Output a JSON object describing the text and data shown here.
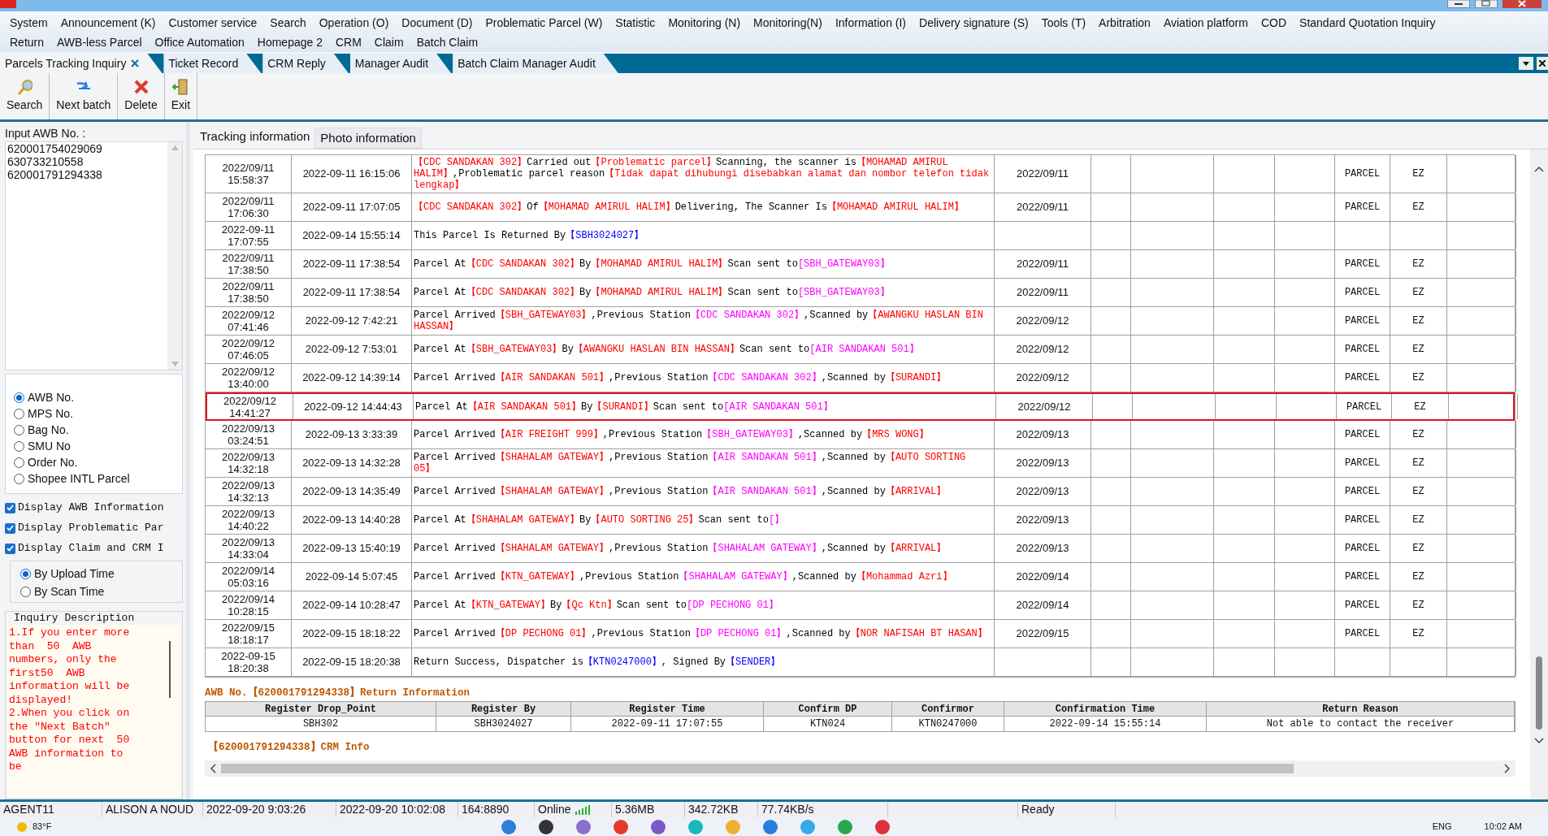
{
  "menu_rows": [
    [
      "System",
      "Announcement (K)",
      "Customer service",
      "Search",
      "Operation (O)",
      "Document (D)",
      "Problematic Parcel (W)",
      "Statistic",
      "Monitoring (N)",
      "Monitoring(N)",
      "Information (I)",
      "Delivery signature (S)",
      "Tools (T)",
      "Arbitration",
      "Aviation platform",
      "COD",
      "Standard Quotation Inquiry"
    ],
    [
      "Return",
      "AWB-less Parcel",
      "Office Automation",
      "Homepage 2",
      "CRM",
      "Claim",
      "Batch Claim"
    ]
  ],
  "doc_tabs": [
    {
      "label": "Parcels Tracking Inquiry",
      "selected": true
    },
    {
      "label": "Ticket Record",
      "selected": false
    },
    {
      "label": "CRM Reply",
      "selected": false
    },
    {
      "label": "Manager Audit",
      "selected": false
    },
    {
      "label": "Batch Claim Manager Audit",
      "selected": false
    }
  ],
  "toolbar": [
    {
      "label": "Search",
      "kind": "search"
    },
    {
      "label": "Next batch",
      "kind": "next"
    },
    {
      "label": "Delete",
      "kind": "delete"
    },
    {
      "label": "Exit",
      "kind": "exit"
    }
  ],
  "awb_input": {
    "label": "Input AWB No. :",
    "lines": [
      "620001754029069",
      "630733210558",
      "620001791294338"
    ]
  },
  "search_type": [
    {
      "label": "AWB No.",
      "selected": true
    },
    {
      "label": "MPS No.",
      "selected": false
    },
    {
      "label": "Bag No.",
      "selected": false
    },
    {
      "label": "SMU No",
      "selected": false
    },
    {
      "label": "Order No.",
      "selected": false
    },
    {
      "label": "Shopee INTL Parcel",
      "selected": false
    }
  ],
  "display_options": [
    {
      "label": "Display AWB Information",
      "checked": true
    },
    {
      "label": "Display Problematic Par",
      "checked": true
    },
    {
      "label": "Display Claim and CRM I",
      "checked": true
    }
  ],
  "time_order": [
    {
      "label": "By Upload Time",
      "selected": true
    },
    {
      "label": "By Scan Time",
      "selected": false
    }
  ],
  "inquiry_description": {
    "title": "Inquiry Description",
    "text": "1.If you enter more than  50  AWB numbers, only the first50  AWB information will be displayed!\n2.When you click on the ″Next Batch″ button for next  50 AWB information to be"
  },
  "info_tabs": [
    {
      "label": "Tracking information",
      "selected": true
    },
    {
      "label": "Photo information",
      "selected": false
    }
  ],
  "tracking_rows": [
    {
      "scan_time": "2022/09/11 15:58:37",
      "upload_time": "2022-09-11 16:15:06",
      "description": [
        {
          "text": "【CDC SANDAKAN 302】",
          "color": "#ff0000"
        },
        {
          "text": "Carried out",
          "color": "#000000"
        },
        {
          "text": "【Problematic parcel】",
          "color": "#ff0000"
        },
        {
          "text": "Scanning, the scanner is",
          "color": "#000000"
        },
        {
          "text": "【MOHAMAD AMIRUL HALIM】",
          "color": "#ff0000"
        },
        {
          "text": ",Problematic parcel reason",
          "color": "#000000"
        },
        {
          "text": "【Tidak dapat dihubungi disebabkan alamat dan nombor telefon tidak lengkap】",
          "color": "#ff0000"
        }
      ],
      "date": "2022/09/11",
      "type": "PARCEL",
      "code": "EZ",
      "selected": false
    },
    {
      "scan_time": "2022/09/11 17:06:30",
      "upload_time": "2022-09-11 17:07:05",
      "description": [
        {
          "text": "【CDC SANDAKAN 302】",
          "color": "#ff0000"
        },
        {
          "text": "Of",
          "color": "#000000"
        },
        {
          "text": "【MOHAMAD AMIRUL HALIM】",
          "color": "#ff0000"
        },
        {
          "text": "Delivering, The Scanner Is",
          "color": "#000000"
        },
        {
          "text": "【MOHAMAD AMIRUL HALIM】",
          "color": "#ff0000"
        }
      ],
      "date": "2022/09/11",
      "type": "PARCEL",
      "code": "EZ",
      "selected": false
    },
    {
      "scan_time": "2022-09-11 17:07:55",
      "upload_time": "2022-09-14 15:55:14",
      "description": [
        {
          "text": "This Parcel Is Returned By",
          "color": "#000000"
        },
        {
          "text": "【SBH3024027】",
          "color": "#0000ff"
        }
      ],
      "selected": false
    },
    {
      "scan_time": "2022/09/11 17:38:50",
      "upload_time": "2022-09-11 17:38:54",
      "description": [
        {
          "text": "Parcel At",
          "color": "#000000"
        },
        {
          "text": "【CDC SANDAKAN 302】",
          "color": "#ff0000"
        },
        {
          "text": "By",
          "color": "#000000"
        },
        {
          "text": "【MOHAMAD AMIRUL HALIM】",
          "color": "#ff0000"
        },
        {
          "text": "Scan sent to",
          "color": "#000000"
        },
        {
          "text": "[SBH_GATEWAY03】",
          "color": "#ff00ff"
        }
      ],
      "date": "2022/09/11",
      "type": "PARCEL",
      "code": "EZ",
      "selected": false
    },
    {
      "scan_time": "2022/09/11 17:38:50",
      "upload_time": "2022-09-11 17:38:54",
      "description": [
        {
          "text": "Parcel At",
          "color": "#000000"
        },
        {
          "text": "【CDC SANDAKAN 302】",
          "color": "#ff0000"
        },
        {
          "text": "By",
          "color": "#000000"
        },
        {
          "text": "【MOHAMAD AMIRUL HALIM】",
          "color": "#ff0000"
        },
        {
          "text": "Scan sent to",
          "color": "#000000"
        },
        {
          "text": "[SBH_GATEWAY03】",
          "color": "#ff00ff"
        }
      ],
      "date": "2022/09/11",
      "type": "PARCEL",
      "code": "EZ",
      "selected": false
    },
    {
      "scan_time": "2022/09/12 07:41:46",
      "upload_time": "2022-09-12 7:42:21",
      "description": [
        {
          "text": "Parcel Arrived",
          "color": "#000000"
        },
        {
          "text": "【SBH_GATEWAY03】",
          "color": "#ff0000"
        },
        {
          "text": ",Previous Station",
          "color": "#000000"
        },
        {
          "text": "【CDC SANDAKAN 302】",
          "color": "#ff00ff"
        },
        {
          "text": ",Scanned by",
          "color": "#000000"
        },
        {
          "text": "【AWANGKU HASLAN BIN HASSAN】",
          "color": "#ff0000"
        }
      ],
      "date": "2022/09/12",
      "type": "PARCEL",
      "code": "EZ",
      "selected": false
    },
    {
      "scan_time": "2022/09/12 07:46:05",
      "upload_time": "2022-09-12 7:53:01",
      "description": [
        {
          "text": "Parcel At",
          "color": "#000000"
        },
        {
          "text": "【SBH_GATEWAY03】",
          "color": "#ff0000"
        },
        {
          "text": "By",
          "color": "#000000"
        },
        {
          "text": "【AWANGKU HASLAN BIN HASSAN】",
          "color": "#ff0000"
        },
        {
          "text": "Scan sent to",
          "color": "#000000"
        },
        {
          "text": "[AIR SANDAKAN 501】",
          "color": "#ff00ff"
        }
      ],
      "date": "2022/09/12",
      "type": "PARCEL",
      "code": "EZ",
      "selected": false
    },
    {
      "scan_time": "2022/09/12 13:40:00",
      "upload_time": "2022-09-12 14:39:14",
      "description": [
        {
          "text": "Parcel Arrived",
          "color": "#000000"
        },
        {
          "text": "【AIR SANDAKAN 501】",
          "color": "#ff0000"
        },
        {
          "text": ",Previous Station",
          "color": "#000000"
        },
        {
          "text": "【CDC SANDAKAN 302】",
          "color": "#ff00ff"
        },
        {
          "text": ",Scanned by",
          "color": "#000000"
        },
        {
          "text": "【SURANDI】",
          "color": "#ff0000"
        }
      ],
      "date": "2022/09/12",
      "type": "PARCEL",
      "code": "EZ",
      "selected": false
    },
    {
      "scan_time": "2022/09/12 14:41:27",
      "upload_time": "2022-09-12 14:44:43",
      "description": [
        {
          "text": "Parcel At",
          "color": "#000000"
        },
        {
          "text": "【AIR SANDAKAN 501】",
          "color": "#ff0000"
        },
        {
          "text": "By",
          "color": "#000000"
        },
        {
          "text": "【SURANDI】",
          "color": "#ff0000"
        },
        {
          "text": "Scan sent to",
          "color": "#000000"
        },
        {
          "text": "[AIR SANDAKAN 501】",
          "color": "#ff00ff"
        }
      ],
      "date": "2022/09/12",
      "type": "PARCEL",
      "code": "EZ",
      "selected": true
    },
    {
      "scan_time": "2022/09/13 03:24:51",
      "upload_time": "2022-09-13 3:33:39",
      "description": [
        {
          "text": "Parcel Arrived",
          "color": "#000000"
        },
        {
          "text": "【AIR FREIGHT 999】",
          "color": "#ff0000"
        },
        {
          "text": ",Previous Station",
          "color": "#000000"
        },
        {
          "text": "【SBH_GATEWAY03】",
          "color": "#ff00ff"
        },
        {
          "text": ",Scanned by",
          "color": "#000000"
        },
        {
          "text": "【MRS WONG】",
          "color": "#ff0000"
        }
      ],
      "date": "2022/09/13",
      "type": "PARCEL",
      "code": "EZ",
      "selected": false
    },
    {
      "scan_time": "2022/09/13 14:32:18",
      "upload_time": "2022-09-13 14:32:28",
      "description": [
        {
          "text": "Parcel Arrived",
          "color": "#000000"
        },
        {
          "text": "【SHAHALAM GATEWAY】",
          "color": "#ff0000"
        },
        {
          "text": ",Previous Station",
          "color": "#000000"
        },
        {
          "text": "【AIR SANDAKAN 501】",
          "color": "#ff00ff"
        },
        {
          "text": ",Scanned by",
          "color": "#000000"
        },
        {
          "text": "【AUTO SORTING 05】",
          "color": "#ff0000"
        }
      ],
      "date": "2022/09/13",
      "type": "PARCEL",
      "code": "EZ",
      "selected": false
    },
    {
      "scan_time": "2022/09/13 14:32:13",
      "upload_time": "2022-09-13 14:35:49",
      "description": [
        {
          "text": "Parcel Arrived",
          "color": "#000000"
        },
        {
          "text": "【SHAHALAM GATEWAY】",
          "color": "#ff0000"
        },
        {
          "text": ",Previous Station",
          "color": "#000000"
        },
        {
          "text": "【AIR SANDAKAN 501】",
          "color": "#ff00ff"
        },
        {
          "text": ",Scanned by",
          "color": "#000000"
        },
        {
          "text": "【ARRIVAL】",
          "color": "#ff0000"
        }
      ],
      "date": "2022/09/13",
      "type": "PARCEL",
      "code": "EZ",
      "selected": false
    },
    {
      "scan_time": "2022/09/13 14:40:22",
      "upload_time": "2022-09-13 14:40:28",
      "description": [
        {
          "text": "Parcel At",
          "color": "#000000"
        },
        {
          "text": "【SHAHALAM GATEWAY】",
          "color": "#ff0000"
        },
        {
          "text": "By",
          "color": "#000000"
        },
        {
          "text": "【AUTO SORTING 25】",
          "color": "#ff0000"
        },
        {
          "text": "Scan sent to",
          "color": "#000000"
        },
        {
          "text": "[】",
          "color": "#ff00ff"
        }
      ],
      "date": "2022/09/13",
      "type": "PARCEL",
      "code": "EZ",
      "selected": false
    },
    {
      "scan_time": "2022/09/13 14:33:04",
      "upload_time": "2022-09-13 15:40:19",
      "description": [
        {
          "text": "Parcel Arrived",
          "color": "#000000"
        },
        {
          "text": "【SHAHALAM GATEWAY】",
          "color": "#ff0000"
        },
        {
          "text": ",Previous Station",
          "color": "#000000"
        },
        {
          "text": "【SHAHALAM GATEWAY】",
          "color": "#ff00ff"
        },
        {
          "text": ",Scanned by",
          "color": "#000000"
        },
        {
          "text": "【ARRIVAL】",
          "color": "#ff0000"
        }
      ],
      "date": "2022/09/13",
      "type": "PARCEL",
      "code": "EZ",
      "selected": false
    },
    {
      "scan_time": "2022/09/14 05:03:16",
      "upload_time": "2022-09-14 5:07:45",
      "description": [
        {
          "text": "Parcel Arrived",
          "color": "#000000"
        },
        {
          "text": "【KTN_GATEWAY】",
          "color": "#ff0000"
        },
        {
          "text": ",Previous Station",
          "color": "#000000"
        },
        {
          "text": "【SHAHALAM GATEWAY】",
          "color": "#ff00ff"
        },
        {
          "text": ",Scanned by",
          "color": "#000000"
        },
        {
          "text": "【Mohammad Azri】",
          "color": "#ff0000"
        }
      ],
      "date": "2022/09/14",
      "type": "PARCEL",
      "code": "EZ",
      "selected": false
    },
    {
      "scan_time": "2022/09/14 10:28:15",
      "upload_time": "2022-09-14 10:28:47",
      "description": [
        {
          "text": "Parcel At",
          "color": "#000000"
        },
        {
          "text": "【KTN_GATEWAY】",
          "color": "#ff0000"
        },
        {
          "text": "By",
          "color": "#000000"
        },
        {
          "text": "【Qc Ktn】",
          "color": "#ff0000"
        },
        {
          "text": "Scan sent to",
          "color": "#000000"
        },
        {
          "text": "[DP PECHONG 01】",
          "color": "#ff00ff"
        }
      ],
      "date": "2022/09/14",
      "type": "PARCEL",
      "code": "EZ",
      "selected": false
    },
    {
      "scan_time": "2022/09/15 18:18:17",
      "upload_time": "2022-09-15 18:18:22",
      "description": [
        {
          "text": "Parcel Arrived",
          "color": "#000000"
        },
        {
          "text": "【DP PECHONG 01】",
          "color": "#ff0000"
        },
        {
          "text": ",Previous Station",
          "color": "#000000"
        },
        {
          "text": "【DP PECHONG 01】",
          "color": "#ff00ff"
        },
        {
          "text": ",Scanned by",
          "color": "#000000"
        },
        {
          "text": "【NOR NAFISAH BT HASAN】",
          "color": "#ff0000"
        }
      ],
      "date": "2022/09/15",
      "type": "PARCEL",
      "code": "EZ",
      "selected": false
    },
    {
      "scan_time": "2022-09-15 18:20:38",
      "upload_time": "2022-09-15 18:20:38",
      "description": [
        {
          "text": "Return Success, Dispatcher is",
          "color": "#000000"
        },
        {
          "text": "【KTN0247000】",
          "color": "#0000ff"
        },
        {
          "text": ", Signed By",
          "color": "#000000"
        },
        {
          "text": "【SENDER】",
          "color": "#0000ff"
        }
      ],
      "selected": false
    }
  ],
  "return_info": {
    "title": "AWB No.【620001791294338】Return Information",
    "columns": [
      "Register Drop_Point",
      "Register By",
      "Register Time",
      "Confirm DP",
      "Confirmor",
      "Confirmation Time",
      "Return Reason"
    ],
    "row": [
      "SBH302",
      "SBH3024027",
      "2022-09-11 17:07:55",
      "KTN024",
      "KTN0247000",
      "2022-09-14 15:55:14",
      "Not able to contact the receiver"
    ]
  },
  "crm_info": {
    "title": "【620001791294338】CRM Info"
  },
  "status_bar": [
    "AGENT11",
    "ALISON A NOUD",
    "2022-09-20 9:03:26",
    "2022-09-20 10:02:08",
    "164:8890",
    "Online",
    "5.36MB",
    "342.72KB",
    "77.74KB/s",
    "Ready"
  ],
  "taskbar": {
    "weather": "83°F",
    "language": "ENG",
    "time": "10:02 AM"
  }
}
